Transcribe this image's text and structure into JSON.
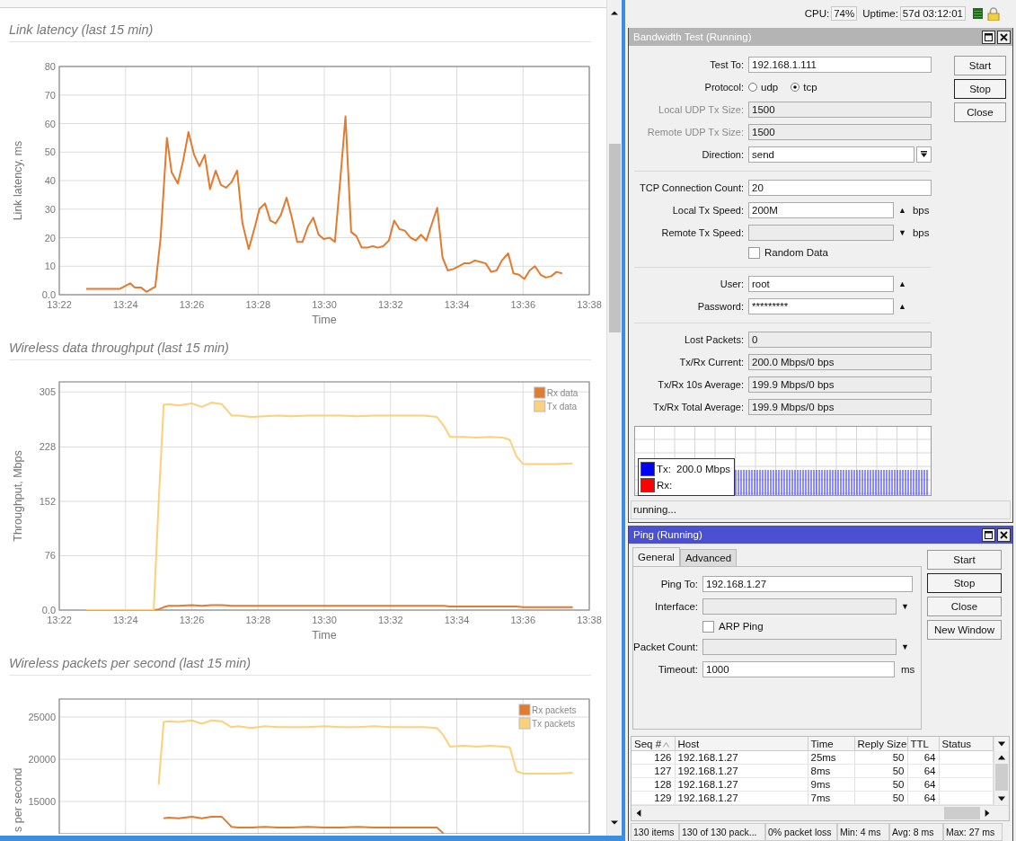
{
  "web_panel": {
    "sections": [
      {
        "title": "Link latency (last 15 min)",
        "chart_data": {
          "type": "line",
          "grid": true,
          "xlabel": "Time",
          "ylabel": "Link latency, ms",
          "xlim": [
            802,
            818
          ],
          "ylim": [
            0,
            80
          ],
          "xticks": [
            {
              "value": 802,
              "label": "13:22"
            },
            {
              "value": 804,
              "label": "13:24"
            },
            {
              "value": 806,
              "label": "13:26"
            },
            {
              "value": 808,
              "label": "13:28"
            },
            {
              "value": 810,
              "label": "13:30"
            },
            {
              "value": 812,
              "label": "13:32"
            },
            {
              "value": 814,
              "label": "13:34"
            },
            {
              "value": 816,
              "label": "13:36"
            },
            {
              "value": 818,
              "label": "13:38"
            }
          ],
          "yticks": [
            {
              "value": 0,
              "label": "0.0"
            },
            10,
            20,
            30,
            40,
            50,
            60,
            70,
            80
          ],
          "x": [
            802.81,
            803.82,
            804.14,
            804.28,
            804.47,
            804.63,
            804.9,
            805.06,
            805.25,
            805.39,
            805.58,
            805.74,
            805.9,
            806.07,
            806.23,
            806.39,
            806.55,
            806.72,
            806.88,
            807.04,
            807.2,
            807.37,
            807.53,
            807.72,
            807.91,
            808.04,
            808.21,
            808.37,
            808.53,
            808.69,
            808.86,
            809.02,
            809.18,
            809.34,
            809.51,
            809.67,
            809.83,
            809.99,
            810.16,
            810.32,
            810.48,
            810.64,
            810.81,
            810.97,
            811.13,
            811.3,
            811.46,
            811.62,
            811.78,
            811.95,
            812.11,
            812.27,
            812.43,
            812.6,
            812.76,
            812.92,
            813.08,
            813.41,
            813.57,
            813.73,
            813.9,
            814.06,
            814.22,
            814.38,
            814.55,
            814.71,
            814.87,
            815.04,
            815.2,
            815.36,
            815.55,
            815.71,
            815.88,
            816.04,
            816.2,
            816.36,
            816.53,
            816.69,
            816.85,
            817.01,
            817.18
          ],
          "series": [
            {
              "color": "#e07b30",
              "values": [
                2,
                2,
                4,
                2.5,
                2.5,
                1,
                2.8,
                20,
                55,
                43,
                39,
                47,
                57,
                49,
                45,
                49,
                37,
                43.5,
                38.5,
                37.5,
                39.5,
                43.5,
                25,
                16,
                24,
                30,
                32,
                26,
                25,
                28,
                34,
                27,
                18.5,
                18.5,
                24,
                27,
                21,
                19.5,
                20,
                18.5,
                40,
                62.5,
                22,
                20.5,
                16.5,
                16.5,
                17,
                16.5,
                17,
                19,
                26,
                23,
                22.5,
                20,
                19,
                21,
                19,
                30.5,
                13,
                8.5,
                9,
                10,
                11,
                11,
                12,
                11.5,
                11,
                8,
                8.5,
                12,
                14.5,
                7.5,
                7,
                5.5,
                8.5,
                10,
                7,
                6,
                6.5,
                8,
                7.5
              ]
            }
          ]
        }
      },
      {
        "title": "Wireless data throughput (last 15 min)",
        "chart_data": {
          "type": "line",
          "grid": true,
          "legend": true,
          "xlabel": "Time",
          "ylabel": "Throughput, Mbps",
          "xlim": [
            802,
            818
          ],
          "ylim": [
            0,
            319
          ],
          "xticks": [
            {
              "value": 802,
              "label": "13:22"
            },
            {
              "value": 804,
              "label": "13:24"
            },
            {
              "value": 806,
              "label": "13:26"
            },
            {
              "value": 808,
              "label": "13:28"
            },
            {
              "value": 810,
              "label": "13:30"
            },
            {
              "value": 812,
              "label": "13:32"
            },
            {
              "value": 814,
              "label": "13:34"
            },
            {
              "value": 816,
              "label": "13:36"
            },
            {
              "value": 818,
              "label": "13:38"
            }
          ],
          "yticks": [
            {
              "value": 0,
              "label": "0.0"
            },
            76,
            152,
            228,
            305
          ],
          "x": [
            802.8,
            803.5,
            804.5,
            804.85,
            805.0,
            805.15,
            805.3,
            805.6,
            806.0,
            806.3,
            806.6,
            806.9,
            807.2,
            807.4,
            807.8,
            808.2,
            808.6,
            809.0,
            809.5,
            810.0,
            810.5,
            811.0,
            811.5,
            812.0,
            812.5,
            813.0,
            813.4,
            813.6,
            813.8,
            814.2,
            814.6,
            815.0,
            815.4,
            815.6,
            815.8,
            816.0,
            816.5,
            817.0,
            817.5
          ],
          "series": [
            {
              "name": "Rx data",
              "color": "#e07b30",
              "values": [
                0,
                0,
                0,
                0,
                1,
                4,
                6,
                6,
                7,
                6,
                7,
                7,
                6,
                6,
                6,
                6,
                6,
                6,
                6,
                6,
                6,
                6,
                6,
                6,
                6,
                6,
                6,
                6,
                5,
                5,
                5,
                5,
                5,
                5,
                5,
                4,
                4,
                4,
                4
              ]
            },
            {
              "name": "Tx data",
              "color": "#fdd07a",
              "values": [
                0,
                0,
                0,
                0,
                150,
                287,
                288,
                286,
                289,
                284,
                290,
                288,
                272,
                272,
                270,
                271,
                272,
                271,
                272,
                272,
                272,
                271,
                272,
                272,
                272,
                272,
                270,
                258,
                242,
                242,
                241,
                242,
                241,
                238,
                215,
                204,
                204,
                204,
                205
              ]
            }
          ]
        }
      },
      {
        "title": "Wireless packets per second (last 15 min)",
        "chart_data": {
          "type": "line",
          "grid": true,
          "legend": true,
          "ylabel": "s per second",
          "xlim": [
            802,
            818
          ],
          "ylim": [
            11170,
            27128
          ],
          "yticks": [
            {
              "value": 15000,
              "label": "15000"
            },
            {
              "value": 20000,
              "label": "20000"
            },
            {
              "value": 25000,
              "label": "25000"
            }
          ],
          "x": [
            805.0,
            805.15,
            805.3,
            805.6,
            806.0,
            806.3,
            806.6,
            806.9,
            807.2,
            807.4,
            807.8,
            808.2,
            808.6,
            809.0,
            809.5,
            810.0,
            810.5,
            811.0,
            811.5,
            812.0,
            812.5,
            813.0,
            813.4,
            813.6,
            813.8,
            814.2,
            814.6,
            815.0,
            815.4,
            815.6,
            815.8,
            816.0,
            816.5,
            817.0,
            817.5
          ],
          "series": [
            {
              "name": "Rx packets",
              "color": "#e07b30",
              "values": [
                null,
                13000,
                13100,
                13000,
                13200,
                13000,
                13200,
                13200,
                12000,
                11900,
                11900,
                12000,
                11900,
                11900,
                12000,
                11900,
                11900,
                12000,
                11900,
                11900,
                11900,
                11900,
                11900,
                11200,
                null,
                null,
                null,
                null,
                null,
                null,
                null,
                null,
                null,
                null,
                null
              ]
            },
            {
              "name": "Tx packets",
              "color": "#fdd07a",
              "values": [
                17000,
                24400,
                24500,
                24400,
                24600,
                24200,
                24600,
                24500,
                23800,
                23900,
                23700,
                23900,
                23800,
                23800,
                23800,
                23900,
                23800,
                23800,
                23900,
                23800,
                23800,
                23800,
                23700,
                22800,
                21500,
                21600,
                21500,
                21600,
                21500,
                21400,
                18600,
                18300,
                18300,
                18300,
                18400
              ]
            }
          ]
        }
      }
    ]
  },
  "status_bar": {
    "cpu_label": "CPU:",
    "cpu": "74%",
    "uptime_label": "Uptime:",
    "uptime": "57d 03:12:01"
  },
  "bandwidth_test": {
    "title": "Bandwidth Test (Running)",
    "active": false,
    "fields": [
      {
        "kind": "input",
        "label": "Test To:",
        "value": "192.168.1.111",
        "disabled": false
      },
      {
        "kind": "radio",
        "label": "Protocol:",
        "options": [
          {
            "label": "udp",
            "selected": false
          },
          {
            "label": "tcp",
            "selected": true
          }
        ]
      },
      {
        "kind": "readonly",
        "label": "Local UDP Tx Size:",
        "value": "1500",
        "disabled": true
      },
      {
        "kind": "readonly",
        "label": "Remote UDP Tx Size:",
        "value": "1500",
        "disabled": true
      },
      {
        "kind": "dropdown",
        "label": "Direction:",
        "value": "send",
        "disabled": false
      },
      {
        "kind": "separator"
      },
      {
        "kind": "input",
        "label": "TCP Connection Count:",
        "value": "20",
        "disabled": false
      },
      {
        "kind": "input",
        "label": "Local Tx Speed:",
        "value": "200M",
        "arrow": "▲",
        "unit": "bps",
        "disabled": false
      },
      {
        "kind": "readonly",
        "label": "Remote Tx Speed:",
        "arrow": "▼",
        "unit": "bps",
        "disabled": false
      },
      {
        "kind": "checkbox",
        "label": "Random Data",
        "checked": false
      },
      {
        "kind": "separator"
      },
      {
        "kind": "input",
        "label": "User:",
        "value": "root",
        "arrow": "▲",
        "disabled": false
      },
      {
        "kind": "input",
        "label": "Password:",
        "value": "*********",
        "arrow": "▲",
        "disabled": false
      },
      {
        "kind": "separator"
      },
      {
        "kind": "readonly",
        "label": "Lost Packets:",
        "value": "0",
        "disabled": false
      },
      {
        "kind": "readonly",
        "label": "Tx/Rx Current:",
        "value": "200.0 Mbps/0 bps",
        "disabled": false
      },
      {
        "kind": "readonly",
        "label": "Tx/Rx 10s Average:",
        "value": "199.9 Mbps/0 bps",
        "disabled": false
      },
      {
        "kind": "readonly",
        "label": "Tx/Rx Total Average:",
        "value": "199.9 Mbps/0 bps",
        "disabled": false
      }
    ],
    "buttons": [
      {
        "label": "Start",
        "default": false
      },
      {
        "label": "Stop",
        "default": true
      },
      {
        "label": "Close",
        "default": false
      }
    ],
    "legend": [
      {
        "label": "Tx:",
        "value": "200.0 Mbps",
        "color": "#0000ff"
      },
      {
        "label": "Rx:",
        "color": "#ff0000"
      }
    ],
    "status": "running..."
  },
  "ping": {
    "title": "Ping (Running)",
    "active": true,
    "tabs": [
      {
        "label": "General",
        "selected": true
      },
      {
        "label": "Advanced",
        "selected": false
      }
    ],
    "fields": [
      {
        "kind": "input",
        "label": "Ping To:",
        "value": "192.168.1.27",
        "disabled": false
      },
      {
        "kind": "readonly",
        "label": "Interface:",
        "arrow": "▼",
        "disabled": false
      },
      {
        "kind": "checkbox",
        "label": "ARP Ping",
        "checked": false
      },
      {
        "kind": "readonly",
        "label": "Packet Count:",
        "arrow": "▼",
        "disabled": false
      },
      {
        "kind": "input",
        "label": "Timeout:",
        "value": "1000",
        "unit": "ms",
        "disabled": false
      }
    ],
    "buttons": [
      {
        "label": "Start",
        "default": false
      },
      {
        "label": "Stop",
        "default": true
      },
      {
        "label": "Close",
        "default": false
      },
      {
        "label": "New Window",
        "default": false
      }
    ],
    "table": {
      "columns": [
        {
          "label": "Seq #",
          "sorted": true
        },
        {
          "label": "Host",
          "sorted": false
        },
        {
          "label": "Time",
          "sorted": false
        },
        {
          "label": "Reply Size",
          "sorted": false
        },
        {
          "label": "TTL",
          "sorted": false
        },
        {
          "label": "Status",
          "sorted": false
        }
      ],
      "rows": [
        {
          "cells": [
            "126",
            "192.168.1.27",
            "25ms",
            "50",
            "64"
          ]
        },
        {
          "cells": [
            "127",
            "192.168.1.27",
            "8ms",
            "50",
            "64"
          ]
        },
        {
          "cells": [
            "128",
            "192.168.1.27",
            "9ms",
            "50",
            "64"
          ]
        },
        {
          "cells": [
            "129",
            "192.168.1.27",
            "7ms",
            "50",
            "64"
          ]
        }
      ]
    },
    "status_bar": [
      "130 items",
      "130 of 130 pack...",
      "0% packet loss",
      "Min: 4 ms",
      "Avg: 8 ms",
      "Max: 27 ms"
    ]
  }
}
